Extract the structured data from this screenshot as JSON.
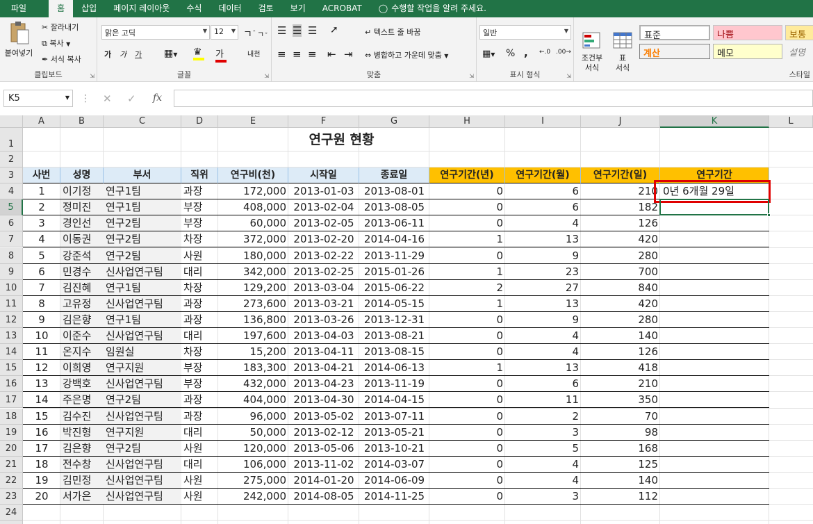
{
  "tabs": [
    "파일",
    "홈",
    "삽입",
    "페이지 레이아웃",
    "수식",
    "데이터",
    "검토",
    "보기",
    "ACROBAT",
    "수행할 작업을 알려 주세요."
  ],
  "ribbon": {
    "clipboard": {
      "paste": "붙여넣기",
      "cut": "잘라내기",
      "copy": "복사",
      "format_painter": "서식 복사",
      "label": "클립보드"
    },
    "font": {
      "name": "맑은 고딕",
      "size": "12",
      "label": "글꼴",
      "bold": "가",
      "italic": "가",
      "underline": "가",
      "font_color": "가",
      "phonetic": "내천"
    },
    "align": {
      "wrap": "텍스트 줄 바꿈",
      "merge": "병합하고 가운데 맞춤",
      "label": "맞춤"
    },
    "number": {
      "format": "일반",
      "percent": "%",
      "comma": ",",
      "label": "표시 형식"
    },
    "styles": {
      "cond": "조건부\n서식",
      "table": "표\n서식",
      "normal": "표준",
      "bad": "나쁨",
      "good": "보통",
      "calc": "계산",
      "memo": "메모",
      "desc": "설명",
      "label": "스타일"
    }
  },
  "namebox": "K5",
  "fx": "fx",
  "columns": [
    "A",
    "B",
    "C",
    "D",
    "E",
    "F",
    "G",
    "H",
    "I",
    "J",
    "K",
    "L"
  ],
  "title": "연구원 현황",
  "headers": [
    "사번",
    "성명",
    "부서",
    "직위",
    "연구비(천)",
    "시작일",
    "종료일",
    "연구기간(년)",
    "연구기간(월)",
    "연구기간(일)",
    "연구기간"
  ],
  "rows": [
    [
      "1",
      "이기정",
      "연구1팀",
      "과장",
      "172,000",
      "2013-01-03",
      "2013-08-01",
      "0",
      "6",
      "210",
      "0년 6개월 29일"
    ],
    [
      "2",
      "정미진",
      "연구1팀",
      "부장",
      "408,000",
      "2013-02-04",
      "2013-08-05",
      "0",
      "6",
      "182",
      ""
    ],
    [
      "3",
      "경인선",
      "연구2팀",
      "부장",
      "60,000",
      "2013-02-05",
      "2013-06-11",
      "0",
      "4",
      "126",
      ""
    ],
    [
      "4",
      "이동권",
      "연구2팀",
      "차장",
      "372,000",
      "2013-02-20",
      "2014-04-16",
      "1",
      "13",
      "420",
      ""
    ],
    [
      "5",
      "강준석",
      "연구2팀",
      "사원",
      "180,000",
      "2013-02-22",
      "2013-11-29",
      "0",
      "9",
      "280",
      ""
    ],
    [
      "6",
      "민경수",
      "신사업연구팀",
      "대리",
      "342,000",
      "2013-02-25",
      "2015-01-26",
      "1",
      "23",
      "700",
      ""
    ],
    [
      "7",
      "김진혜",
      "연구1팀",
      "차장",
      "129,200",
      "2013-03-04",
      "2015-06-22",
      "2",
      "27",
      "840",
      ""
    ],
    [
      "8",
      "고유정",
      "신사업연구팀",
      "과장",
      "273,600",
      "2013-03-21",
      "2014-05-15",
      "1",
      "13",
      "420",
      ""
    ],
    [
      "9",
      "김은향",
      "연구1팀",
      "과장",
      "136,800",
      "2013-03-26",
      "2013-12-31",
      "0",
      "9",
      "280",
      ""
    ],
    [
      "10",
      "이준수",
      "신사업연구팀",
      "대리",
      "197,600",
      "2013-04-03",
      "2013-08-21",
      "0",
      "4",
      "140",
      ""
    ],
    [
      "11",
      "온지수",
      "임원실",
      "차장",
      "15,200",
      "2013-04-11",
      "2013-08-15",
      "0",
      "4",
      "126",
      ""
    ],
    [
      "12",
      "이희영",
      "연구지원",
      "부장",
      "183,300",
      "2013-04-21",
      "2014-06-13",
      "1",
      "13",
      "418",
      ""
    ],
    [
      "13",
      "강백호",
      "신사업연구팀",
      "부장",
      "432,000",
      "2013-04-23",
      "2013-11-19",
      "0",
      "6",
      "210",
      ""
    ],
    [
      "14",
      "주은명",
      "연구2팀",
      "과장",
      "404,000",
      "2013-04-30",
      "2014-04-15",
      "0",
      "11",
      "350",
      ""
    ],
    [
      "15",
      "김수진",
      "신사업연구팀",
      "과장",
      "96,000",
      "2013-05-02",
      "2013-07-11",
      "0",
      "2",
      "70",
      ""
    ],
    [
      "16",
      "박진형",
      "연구지원",
      "대리",
      "50,000",
      "2013-02-12",
      "2013-05-21",
      "0",
      "3",
      "98",
      ""
    ],
    [
      "17",
      "김은향",
      "연구2팀",
      "사원",
      "120,000",
      "2013-05-06",
      "2013-10-21",
      "0",
      "5",
      "168",
      ""
    ],
    [
      "18",
      "전수창",
      "신사업연구팀",
      "대리",
      "106,000",
      "2013-11-02",
      "2014-03-07",
      "0",
      "4",
      "125",
      ""
    ],
    [
      "19",
      "김민정",
      "신사업연구팀",
      "사원",
      "275,000",
      "2014-01-20",
      "2014-06-09",
      "0",
      "4",
      "140",
      ""
    ],
    [
      "20",
      "서가은",
      "신사업연구팀",
      "사원",
      "242,000",
      "2014-08-05",
      "2014-11-25",
      "0",
      "3",
      "112",
      ""
    ]
  ],
  "colors": {
    "accent": "#217346",
    "header_blue": "#ddebf7",
    "header_orange": "#ffc000",
    "highlight": "#e00000"
  }
}
